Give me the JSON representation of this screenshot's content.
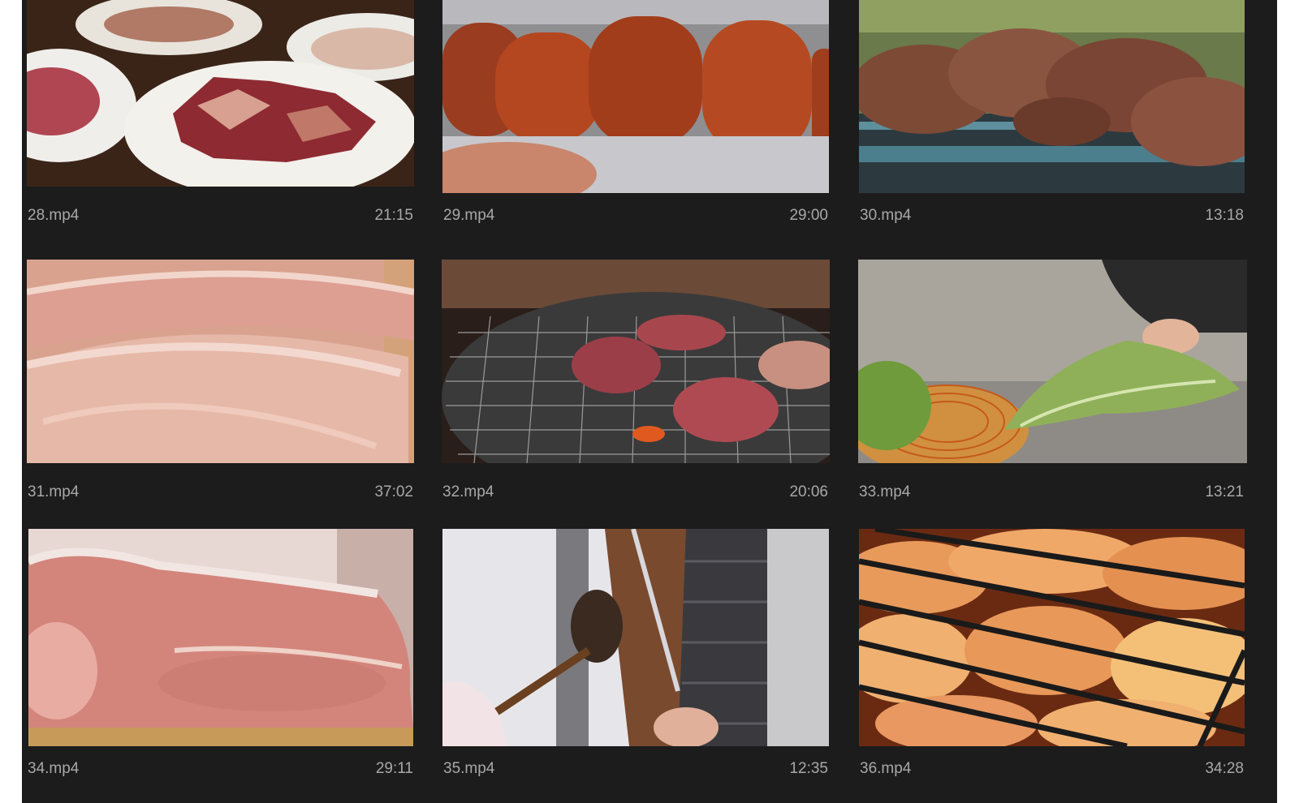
{
  "media_grid": {
    "items": [
      {
        "file": "28.mp4",
        "duration": "21:15",
        "thumbnail": "raw-meat-plates"
      },
      {
        "file": "29.mp4",
        "duration": "29:00",
        "thumbnail": "grilled-sausages"
      },
      {
        "file": "30.mp4",
        "duration": "13:18",
        "thumbnail": "meat-skewers"
      },
      {
        "file": "31.mp4",
        "duration": "37:02",
        "thumbnail": "sliced-raw-pork"
      },
      {
        "file": "32.mp4",
        "duration": "20:06",
        "thumbnail": "charcoal-grill"
      },
      {
        "file": "33.mp4",
        "duration": "13:21",
        "thumbnail": "lettuce-basket"
      },
      {
        "file": "34.mp4",
        "duration": "29:11",
        "thumbnail": "raw-meat-block"
      },
      {
        "file": "35.mp4",
        "duration": "12:35",
        "thumbnail": "doner-kebab"
      },
      {
        "file": "36.mp4",
        "duration": "34:28",
        "thumbnail": "grilled-chicken"
      }
    ]
  },
  "colors": {
    "panel_background": "#1c1c1c",
    "label_text": "#a8a8a8"
  }
}
